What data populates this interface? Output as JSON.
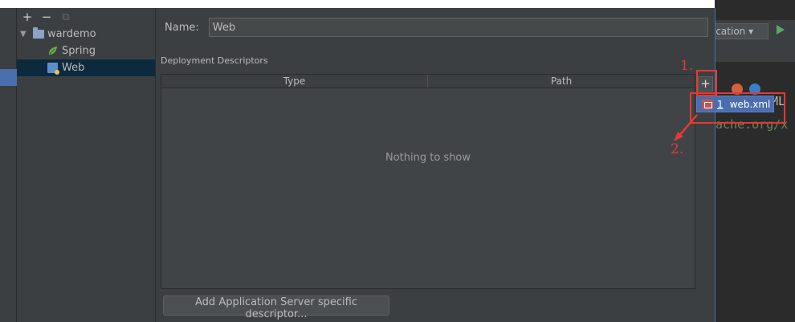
{
  "tree": {
    "toolbar": {
      "add": "+",
      "remove": "−",
      "copy": "⧉"
    },
    "items": [
      {
        "label": "wardemo",
        "icon": "module-folder-icon"
      },
      {
        "label": "Spring",
        "icon": "spring-leaf-icon"
      },
      {
        "label": "Web",
        "icon": "web-facet-icon",
        "selected": true
      }
    ]
  },
  "form": {
    "name_label": "Name:",
    "name_value": "Web",
    "section_label": "Deployment Descriptors",
    "columns": [
      "Type",
      "Path"
    ],
    "empty_text": "Nothing to show",
    "add_descriptor_button": "Add Application Server specific descriptor..."
  },
  "popup": {
    "mnemonic": "1",
    "label": "web.xml"
  },
  "editor": {
    "run_config": "ication",
    "code_line_1": "XML",
    "code_line_2": "ache.org/x"
  },
  "annotations": {
    "step1": "1.",
    "step2": "2."
  },
  "colors": {
    "accent": "#4b6eaf",
    "annotation": "#e53935",
    "background": "#3c3f41"
  }
}
